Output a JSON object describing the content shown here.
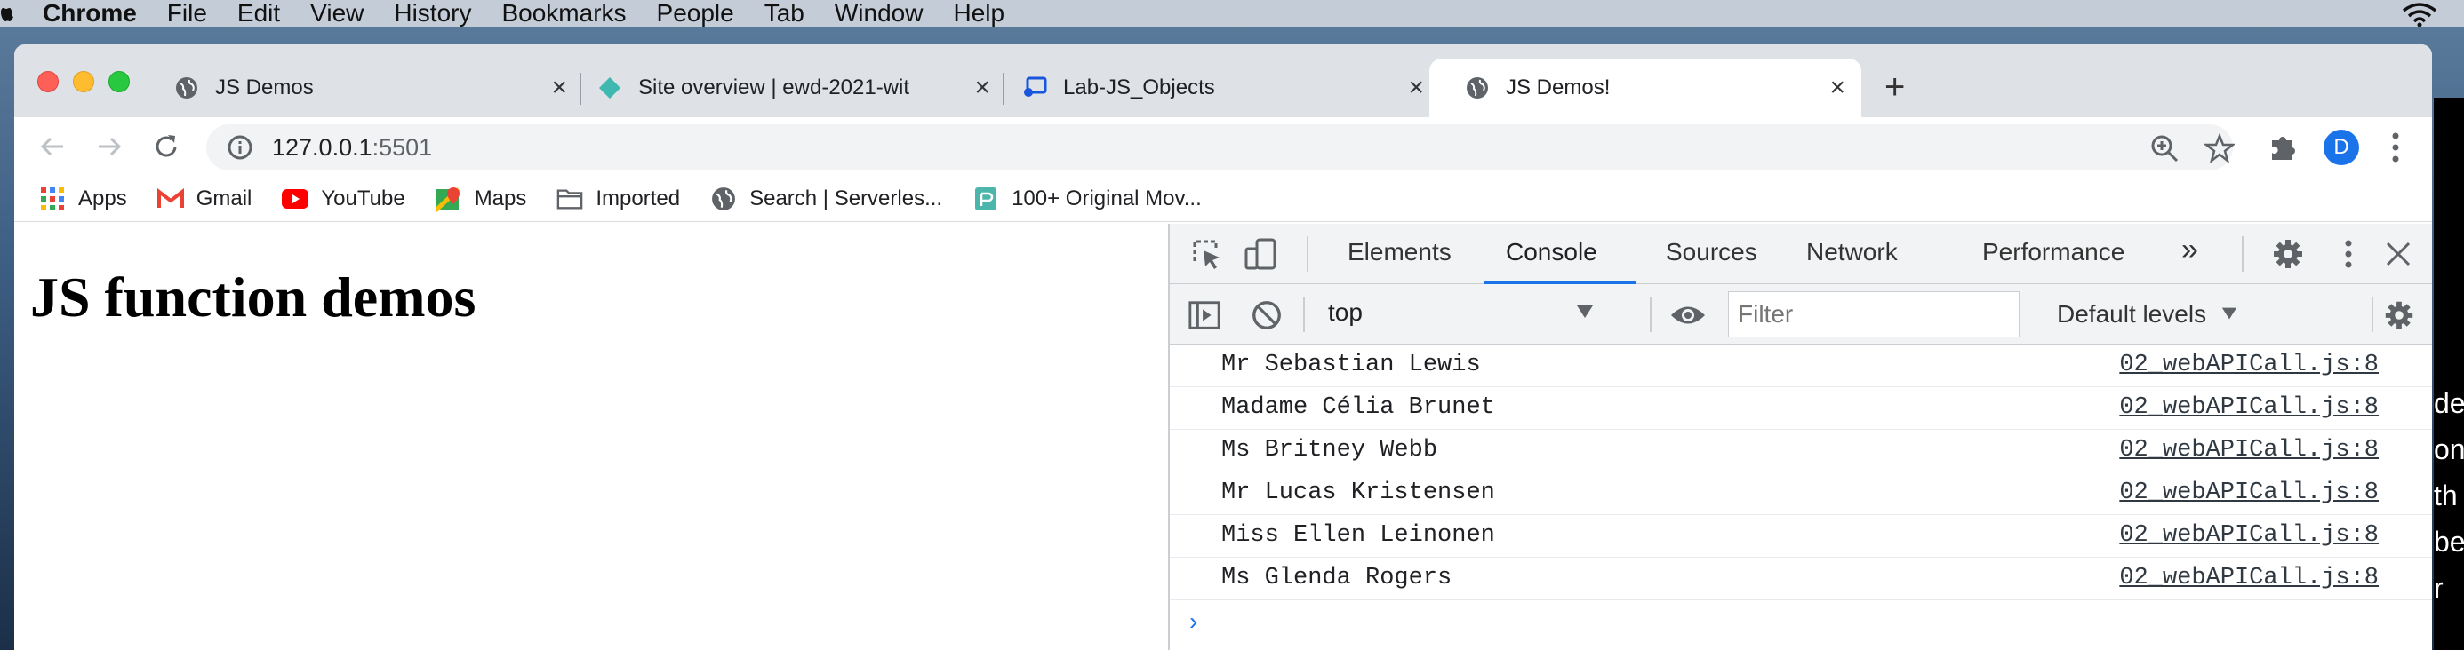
{
  "menubar": {
    "app": "Chrome",
    "items": [
      "File",
      "Edit",
      "View",
      "History",
      "Bookmarks",
      "People",
      "Tab",
      "Window",
      "Help"
    ]
  },
  "tabs": [
    {
      "title": "JS Demos",
      "icon": "globe-icon",
      "active": false
    },
    {
      "title": "Site overview | ewd-2021-wit",
      "icon": "netlify-icon",
      "active": false
    },
    {
      "title": "Lab-JS_Objects",
      "icon": "lab-icon",
      "active": false
    },
    {
      "title": "JS Demos!",
      "icon": "globe-icon",
      "active": true
    }
  ],
  "address": {
    "host": "127.0.0.1",
    "port": ":5501"
  },
  "profile": {
    "initial": "D"
  },
  "bookmarks": [
    {
      "label": "Apps",
      "icon": "apps-grid-icon"
    },
    {
      "label": "Gmail",
      "icon": "gmail-icon"
    },
    {
      "label": "YouTube",
      "icon": "youtube-icon"
    },
    {
      "label": "Maps",
      "icon": "maps-icon"
    },
    {
      "label": "Imported",
      "icon": "folder-icon"
    },
    {
      "label": "Search | Serverles...",
      "icon": "globe-icon"
    },
    {
      "label": "100+ Original Mov...",
      "icon": "page-icon"
    }
  ],
  "page": {
    "heading": "JS function demos"
  },
  "devtools": {
    "tabs": [
      "Elements",
      "Console",
      "Sources",
      "Network",
      "Performance"
    ],
    "more": "»",
    "active_tab": "Console",
    "context": "top",
    "filter_placeholder": "Filter",
    "levels": "Default levels",
    "logs": [
      {
        "message": "Mr Sebastian Lewis",
        "source": "02_webAPICall.js:8"
      },
      {
        "message": "Madame Célia Brunet",
        "source": "02_webAPICall.js:8"
      },
      {
        "message": "Ms Britney Webb",
        "source": "02_webAPICall.js:8"
      },
      {
        "message": "Mr Lucas Kristensen",
        "source": "02_webAPICall.js:8"
      },
      {
        "message": "Miss Ellen Leinonen",
        "source": "02_webAPICall.js:8"
      },
      {
        "message": "Ms Glenda Rogers",
        "source": "02_webAPICall.js:8"
      }
    ],
    "prompt": "›"
  },
  "side_window": {
    "fragments": [
      "de",
      "on",
      "th",
      "be",
      "r"
    ]
  },
  "colors": {
    "accent": "#1a73e8",
    "tabstrip": "#dee1e6"
  }
}
